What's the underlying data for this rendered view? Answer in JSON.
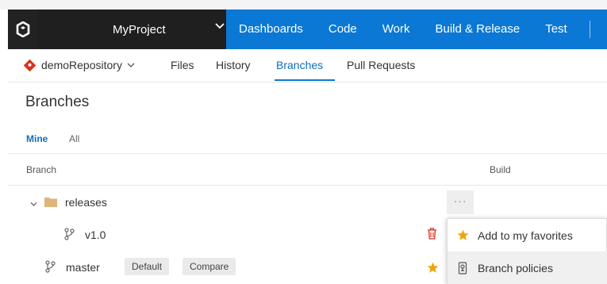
{
  "colors": {
    "nav_blue": "#0a78d4",
    "project_bg": "#1f1f1f",
    "accent_blue": "#106ebe",
    "folder": "#dcb67a",
    "star": "#f0a30a",
    "delete_red": "#d9321c",
    "repo_icon": "#d9321c"
  },
  "navbar": {
    "logo_icon": "vsts-logo-icon",
    "project_name": "MyProject",
    "project_dropdown_icon": "chevron-down-icon",
    "items": [
      "Dashboards",
      "Code",
      "Work",
      "Build & Release",
      "Test"
    ]
  },
  "subnav": {
    "repo_icon": "git-repo-icon",
    "repo_name": "demoRepository",
    "tabs": [
      "Files",
      "History",
      "Branches",
      "Pull Requests"
    ],
    "active_tab": "Branches"
  },
  "page": {
    "title": "Branches",
    "filters": [
      "Mine",
      "All"
    ],
    "active_filter": "Mine"
  },
  "table": {
    "columns": [
      "Branch",
      "Build"
    ],
    "rows": [
      {
        "type": "folder",
        "name": "releases",
        "expanded": true,
        "icon": "folder-icon",
        "more_label": "···"
      },
      {
        "type": "branch",
        "name": "v1.0",
        "icon": "branch-icon",
        "action_icon": "trash-icon"
      },
      {
        "type": "branch",
        "name": "master",
        "icon": "branch-icon",
        "badges": [
          "Default",
          "Compare"
        ],
        "action_icon": "star-icon"
      }
    ]
  },
  "context_menu": {
    "items": [
      {
        "label": "Add to my favorites",
        "icon": "star-icon"
      },
      {
        "label": "Branch policies",
        "icon": "policy-lock-icon"
      }
    ]
  }
}
